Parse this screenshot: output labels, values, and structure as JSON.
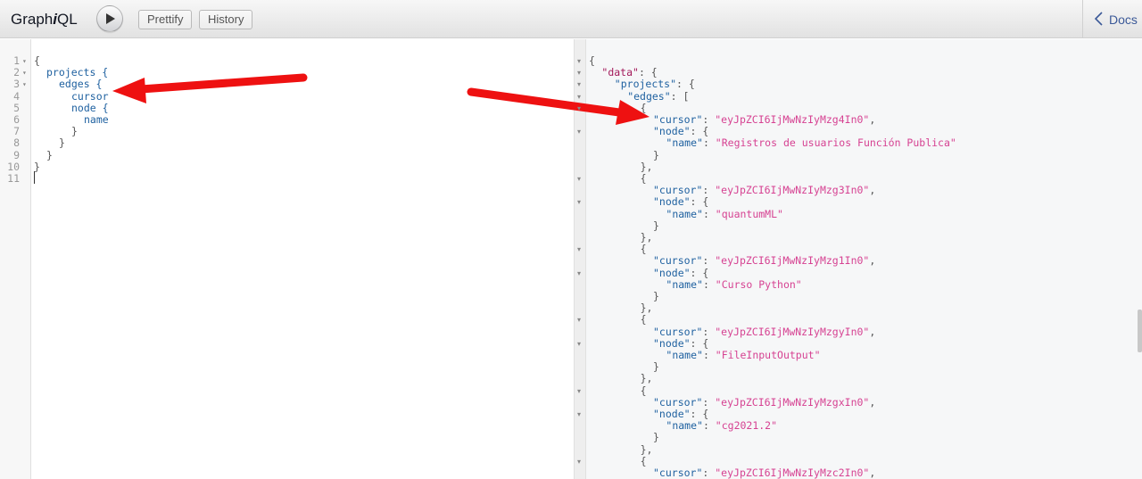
{
  "header": {
    "logo_prefix": "Graph",
    "logo_i": "i",
    "logo_suffix": "QL",
    "prettify_label": "Prettify",
    "history_label": "History",
    "docs_label": "Docs"
  },
  "query_lines": [
    {
      "n": "1",
      "fold": true,
      "indent": 0,
      "text": "{",
      "cls": "p"
    },
    {
      "n": "2",
      "fold": true,
      "indent": 1,
      "text": "projects {",
      "cls": "f"
    },
    {
      "n": "3",
      "fold": true,
      "indent": 2,
      "text": "edges {",
      "cls": "f"
    },
    {
      "n": "4",
      "fold": false,
      "indent": 3,
      "text": "cursor",
      "cls": "f"
    },
    {
      "n": "5",
      "fold": false,
      "indent": 3,
      "text": "node {",
      "cls": "f"
    },
    {
      "n": "6",
      "fold": false,
      "indent": 4,
      "text": "name",
      "cls": "f"
    },
    {
      "n": "7",
      "fold": false,
      "indent": 3,
      "text": "}",
      "cls": "p"
    },
    {
      "n": "8",
      "fold": false,
      "indent": 2,
      "text": "}",
      "cls": "p"
    },
    {
      "n": "9",
      "fold": false,
      "indent": 1,
      "text": "}",
      "cls": "p"
    },
    {
      "n": "10",
      "fold": false,
      "indent": 0,
      "text": "}",
      "cls": "p"
    },
    {
      "n": "11",
      "fold": false,
      "indent": 0,
      "text": "",
      "cls": "p"
    }
  ],
  "result": {
    "data_key": "\"data\"",
    "projects_key": "\"projects\"",
    "edges_key": "\"edges\"",
    "cursor_key": "\"cursor\"",
    "node_key": "\"node\"",
    "name_key": "\"name\"",
    "edges": [
      {
        "cursor": "\"eyJpZCI6IjMwNzIyMzg4In0\"",
        "name": "\"Registros de usuarios Función Publica\""
      },
      {
        "cursor": "\"eyJpZCI6IjMwNzIyMzg3In0\"",
        "name": "\"quantumML\""
      },
      {
        "cursor": "\"eyJpZCI6IjMwNzIyMzg1In0\"",
        "name": "\"Curso Python\""
      },
      {
        "cursor": "\"eyJpZCI6IjMwNzIyMzgyIn0\"",
        "name": "\"FileInputOutput\""
      },
      {
        "cursor": "\"eyJpZCI6IjMwNzIyMzgxIn0\"",
        "name": "\"cg2021.2\""
      },
      {
        "cursor": "\"eyJpZCI6IjMwNzIyMzc2In0\"",
        "name": ""
      }
    ]
  },
  "colors": {
    "accent": "#3b5998",
    "field": "#1f61a0",
    "string": "#d64292",
    "arrow": "#ee1111"
  }
}
